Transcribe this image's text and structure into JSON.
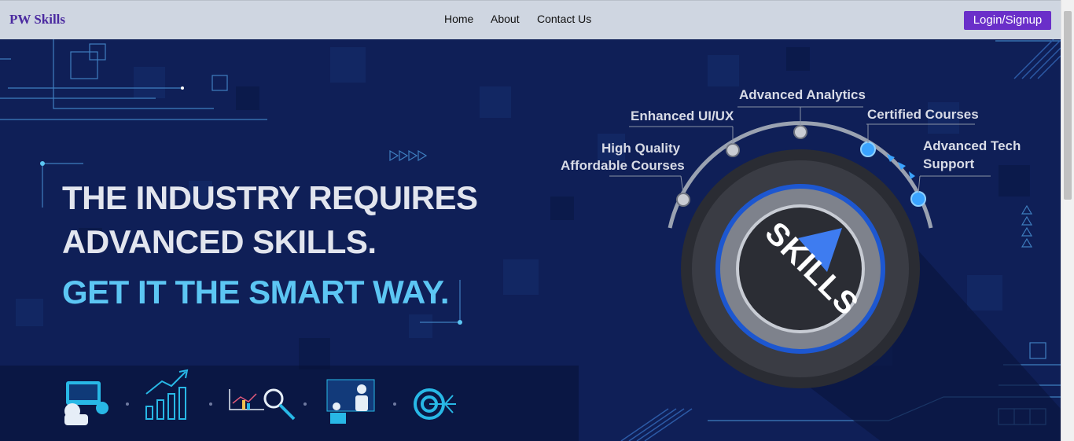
{
  "nav": {
    "brand": "PW Skills",
    "links": [
      "Home",
      "About",
      "Contact Us"
    ],
    "login_label": "Login/Signup"
  },
  "hero": {
    "headline_line1": "THE INDUSTRY REQUIRES",
    "headline_line2": "ADVANCED SKILLS.",
    "tagline": "GET IT THE SMART WAY.",
    "dial_label": "SKILLS",
    "features": {
      "high_quality_line1": "High Quality",
      "high_quality_line2": "Affordable Courses",
      "uiux": "Enhanced UI/UX",
      "analytics": "Advanced Analytics",
      "certified": "Certified Courses",
      "tech_line1": "Advanced Tech",
      "tech_line2": "Support"
    },
    "icons": [
      "developer-icon",
      "growth-chart-icon",
      "analytics-magnifier-icon",
      "presentation-icon",
      "target-icon"
    ]
  },
  "colors": {
    "brand": "#4b2aa0",
    "login_bg": "#6a2fc9",
    "hero_bg": "#0f1f57",
    "accent_blue": "#5cc6f3"
  }
}
